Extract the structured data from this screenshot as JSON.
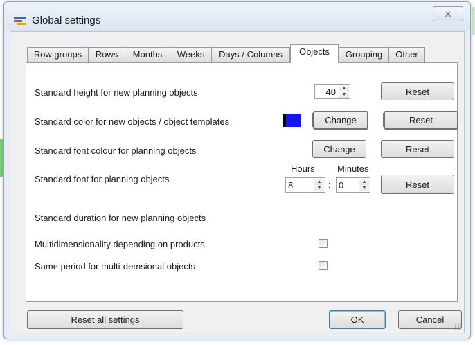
{
  "window": {
    "title": "Global settings",
    "close_glyph": "✕"
  },
  "tabs": [
    {
      "label": "Row groups"
    },
    {
      "label": "Rows"
    },
    {
      "label": "Months"
    },
    {
      "label": "Weeks"
    },
    {
      "label": "Days / Columns"
    },
    {
      "label": "Objects",
      "active": true
    },
    {
      "label": "Grouping"
    },
    {
      "label": "Other"
    }
  ],
  "objects_panel": {
    "height_label": "Standard height for new planning objects",
    "height_value": "40",
    "color_label": "Standard color for new objects / object templates",
    "color_value": "#1515ee",
    "font_colour_label": "Standard font colour for planning objects",
    "font_label": "Standard font for planning objects",
    "duration_label": "Standard duration for new planning objects",
    "hours_label": "Hours",
    "minutes_label": "Minutes",
    "hours_value": "8",
    "minutes_value": "0",
    "time_separator": ":",
    "multidim_label": "Multidimensionality depending on products",
    "same_period_label": "Same period for multi-demsional objects",
    "multidim_checked": false,
    "same_period_checked": false,
    "change_label": "Change",
    "reset_label": "Reset"
  },
  "footer": {
    "reset_all_label": "Reset all settings",
    "ok_label": "OK",
    "cancel_label": "Cancel"
  },
  "icons": {
    "app": "app-icon",
    "spin_up": "▲",
    "spin_down": "▼"
  }
}
